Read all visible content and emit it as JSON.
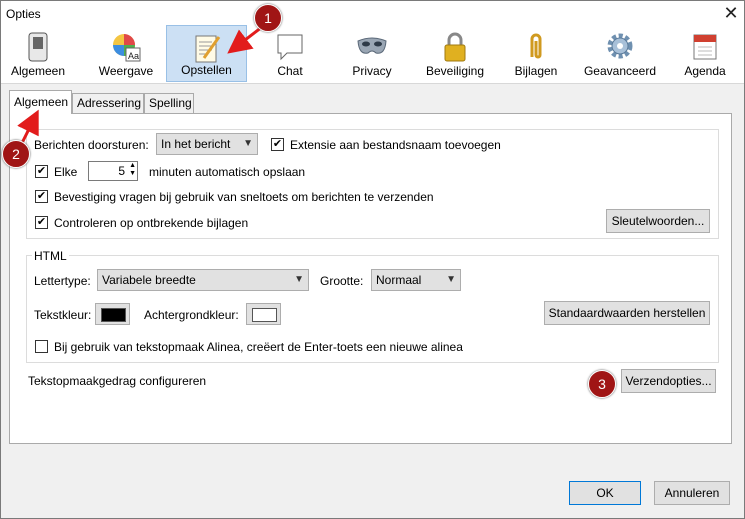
{
  "window": {
    "title": "Opties"
  },
  "toolbar": [
    {
      "label": "Algemeen",
      "icon": "switch-icon"
    },
    {
      "label": "Weergave",
      "icon": "palette-icon"
    },
    {
      "label": "Opstellen",
      "icon": "compose-icon",
      "active": true
    },
    {
      "label": "Chat",
      "icon": "chat-bubble-icon"
    },
    {
      "label": "Privacy",
      "icon": "mask-icon"
    },
    {
      "label": "Beveiliging",
      "icon": "padlock-icon"
    },
    {
      "label": "Bijlagen",
      "icon": "paperclip-icon"
    },
    {
      "label": "Geavanceerd",
      "icon": "gear-icon"
    },
    {
      "label": "Agenda",
      "icon": "calendar-icon"
    }
  ],
  "tabs": [
    "Algemeen",
    "Adressering",
    "Spelling"
  ],
  "general": {
    "forward_label": "Berichten doorsturen:",
    "forward_value": "In het bericht",
    "extension_label": "Extensie aan bestandsnaam toevoegen",
    "every_label": "Elke",
    "every_value": "5",
    "autosave_label": "minuten automatisch opslaan",
    "confirm_label": "Bevestiging vragen bij gebruik van sneltoets om berichten te verzenden",
    "attachments_label": "Controleren op ontbrekende bijlagen",
    "keywords_button": "Sleutelwoorden..."
  },
  "html": {
    "group_title": "HTML",
    "font_label": "Lettertype:",
    "font_value": "Variabele breedte",
    "size_label": "Grootte:",
    "size_value": "Normaal",
    "text_color_label": "Tekstkleur:",
    "bg_color_label": "Achtergrondkleur:",
    "text_color": "#000000",
    "bg_color": "#ffffff",
    "reset_button": "Standaardwaarden herstellen",
    "paragraph_label": "Bij gebruik van tekstopmaak Alinea, creëert de Enter-toets een nieuwe alinea"
  },
  "format": {
    "label": "Tekstopmaakgedrag configureren",
    "button": "Verzendopties..."
  },
  "footer": {
    "ok": "OK",
    "cancel": "Annuleren"
  },
  "badges": [
    "1",
    "2",
    "3"
  ],
  "colors": {
    "badge": "#a01515",
    "arrow": "#e21c1c",
    "active_tab": "#cce0f4"
  }
}
